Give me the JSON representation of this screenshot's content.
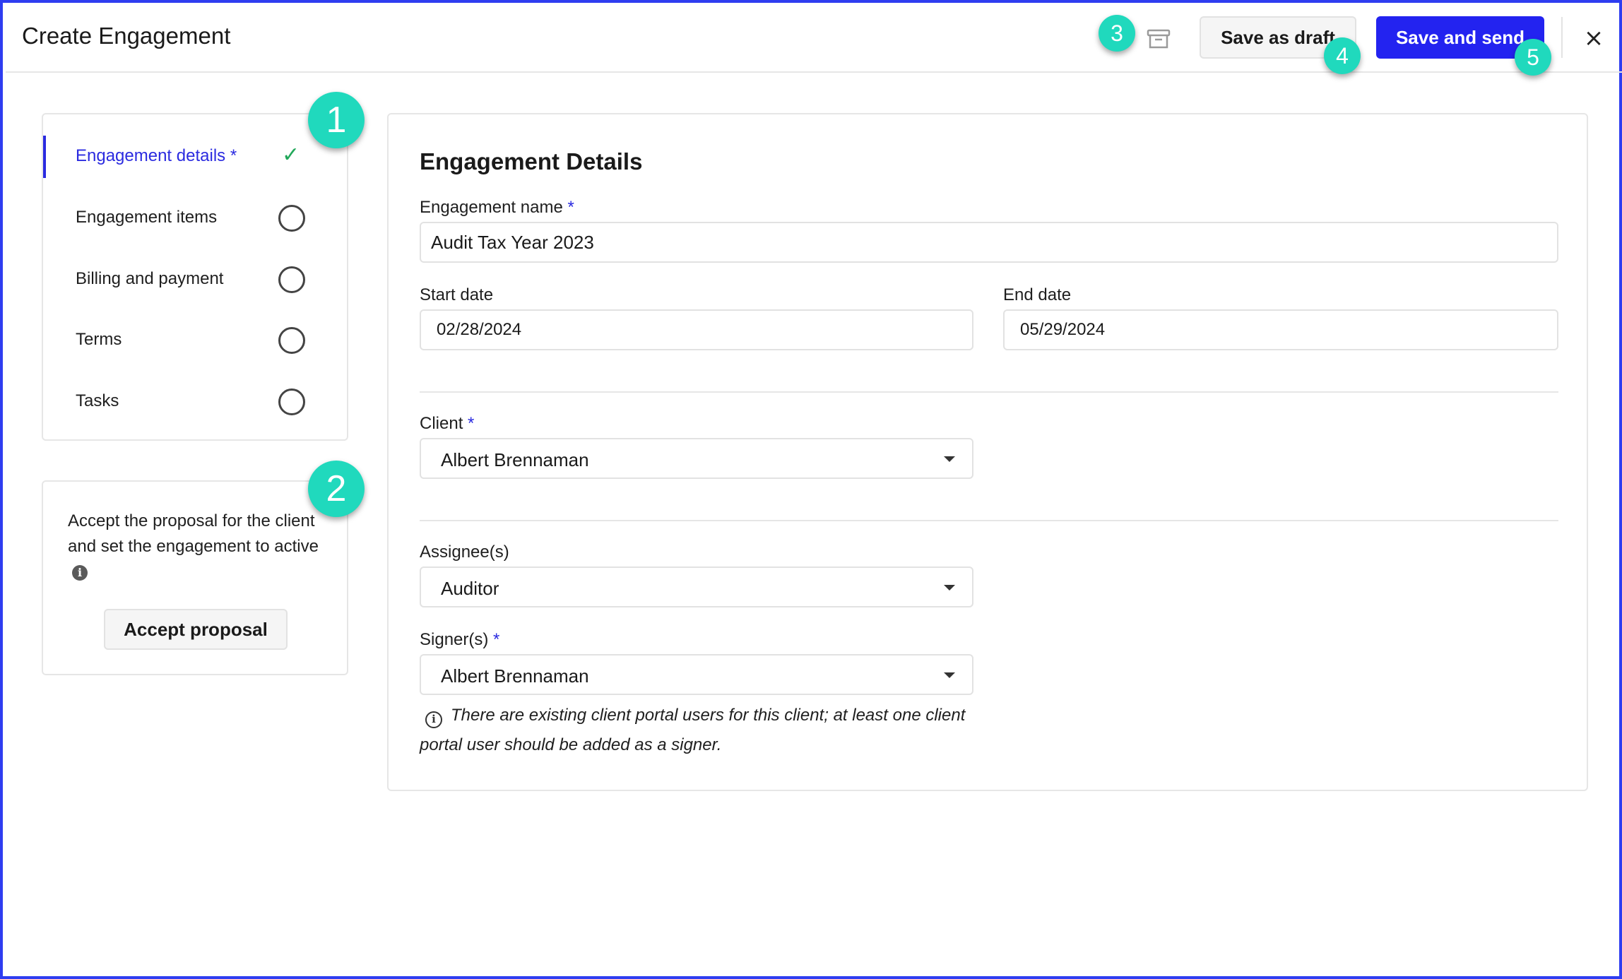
{
  "header": {
    "title": "Create Engagement",
    "archive_icon": "archive-box-icon",
    "save_draft_label": "Save as draft",
    "save_send_label": "Save and send",
    "close_label": "×"
  },
  "badges": [
    "1",
    "2",
    "3",
    "4",
    "5"
  ],
  "sidebar": {
    "items": [
      {
        "label": "Engagement details",
        "required_marker": "*",
        "status": "complete",
        "status_icon": "✓"
      },
      {
        "label": "Engagement items",
        "status": "incomplete"
      },
      {
        "label": "Billing and payment",
        "status": "incomplete"
      },
      {
        "label": "Terms",
        "status": "incomplete"
      },
      {
        "label": "Tasks",
        "status": "incomplete"
      }
    ],
    "accept": {
      "text": "Accept the proposal for the client and set the engagement to active",
      "info_icon": "i",
      "button_label": "Accept proposal"
    }
  },
  "form": {
    "section_title": "Engagement Details",
    "required_marker": "*",
    "engagement_name": {
      "label": "Engagement name",
      "value": "Audit Tax Year 2023"
    },
    "start_date": {
      "label": "Start date",
      "value": "02/28/2024"
    },
    "end_date": {
      "label": "End date",
      "value": "05/29/2024"
    },
    "client": {
      "label": "Client",
      "value": "Albert Brennaman"
    },
    "assignees": {
      "label": "Assignee(s)",
      "value": "Auditor"
    },
    "signers": {
      "label": "Signer(s)",
      "value": "Albert Brennaman"
    },
    "note_icon": "i",
    "note": "There are existing client portal users for this client; at least one client portal user should be added as a signer."
  },
  "colors": {
    "accent": "#2323f0",
    "badge": "#20d9bd",
    "check": "#22a85a",
    "frame": "#2e3df0"
  }
}
